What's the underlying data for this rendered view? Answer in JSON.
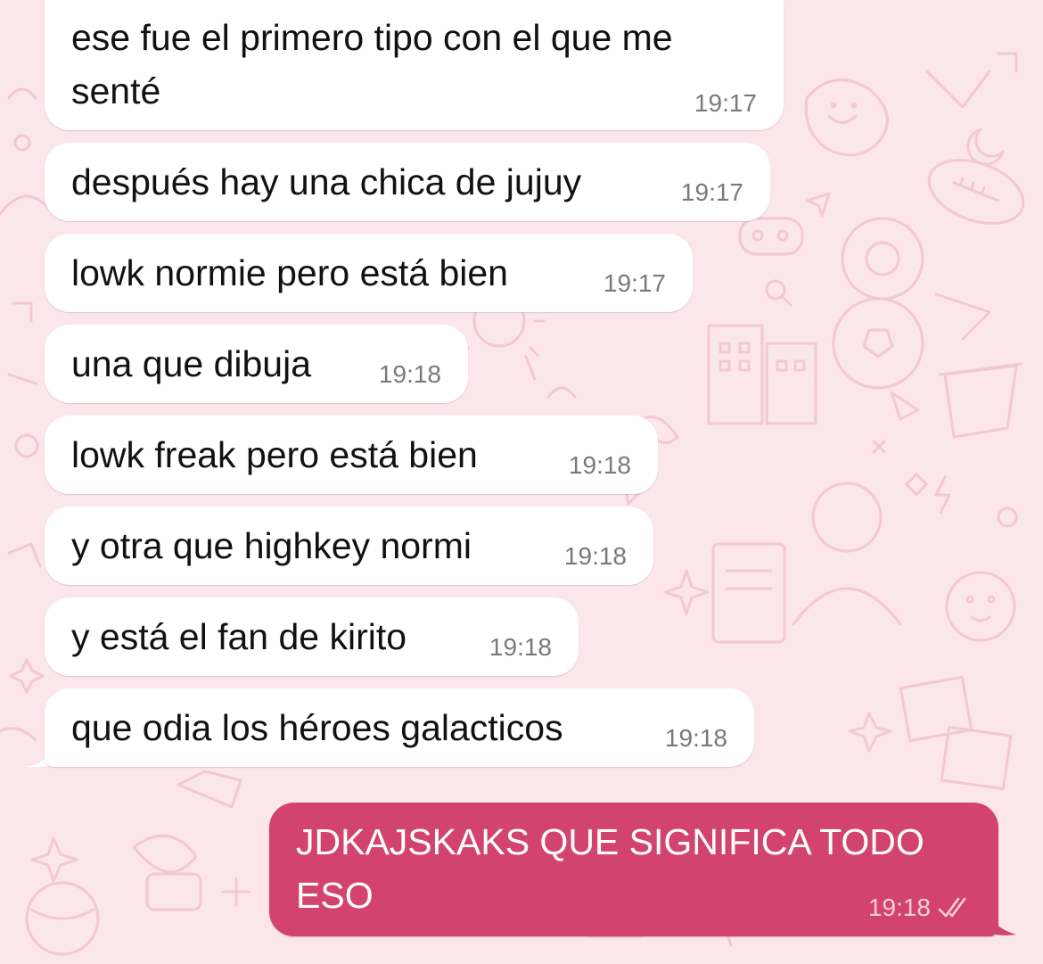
{
  "colors": {
    "background": "#fbe6ec",
    "wallpaper_doodle": "#f2c8d5",
    "incoming_bubble": "#ffffff",
    "outgoing_bubble": "#d3436f",
    "incoming_text": "#111111",
    "outgoing_text": "#ffffff",
    "timestamp_incoming": "#7a7a7a",
    "timestamp_outgoing": "#f6cfdb"
  },
  "messages": [
    {
      "direction": "incoming",
      "lines": [
        "ese fue el primero tipo con el que me",
        "senté"
      ],
      "time": "19:17"
    },
    {
      "direction": "incoming",
      "lines": [
        "después hay una chica de jujuy"
      ],
      "time": "19:17"
    },
    {
      "direction": "incoming",
      "lines": [
        "lowk normie pero está bien"
      ],
      "time": "19:17"
    },
    {
      "direction": "incoming",
      "lines": [
        "una que dibuja"
      ],
      "time": "19:18"
    },
    {
      "direction": "incoming",
      "lines": [
        "lowk freak pero está bien"
      ],
      "time": "19:18"
    },
    {
      "direction": "incoming",
      "lines": [
        "y otra que highkey normi"
      ],
      "time": "19:18"
    },
    {
      "direction": "incoming",
      "lines": [
        "y está el fan de kirito"
      ],
      "time": "19:18"
    },
    {
      "direction": "incoming",
      "lines": [
        "que odia los héroes galacticos"
      ],
      "time": "19:18"
    },
    {
      "direction": "outgoing",
      "lines": [
        "JDKAJSKAKS QUE SIGNIFICA TODO",
        "ESO"
      ],
      "time": "19:18",
      "status_icon": "double-check-icon"
    }
  ]
}
